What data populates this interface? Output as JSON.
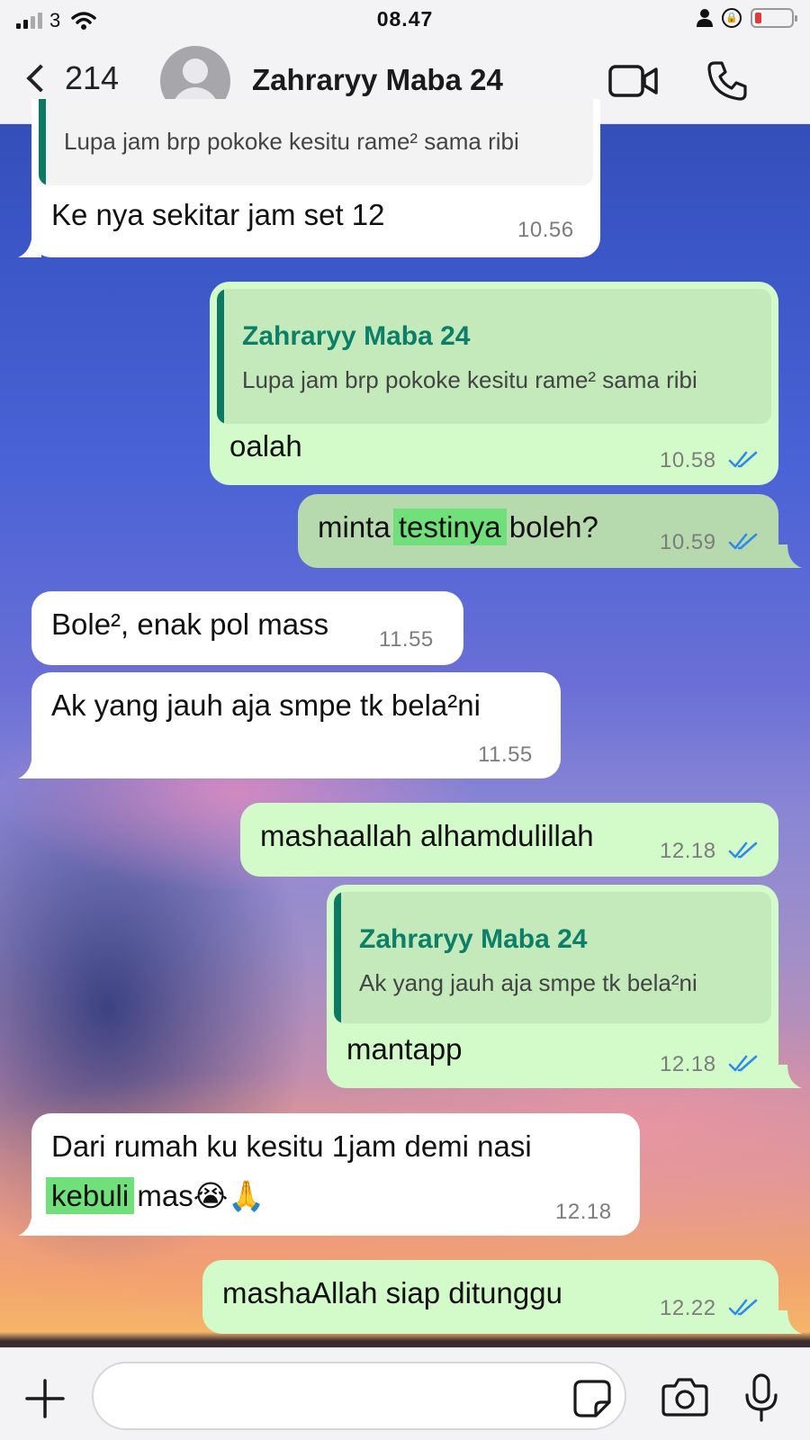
{
  "status_bar": {
    "carrier": "3",
    "time": "08.47"
  },
  "header": {
    "back_count": "214",
    "contact_name": "Zahraryy Maba 24"
  },
  "colors": {
    "incoming_bubble": "#ffffff",
    "outgoing_bubble": "#d3fbc9",
    "selected_bubble": "#b6d9ad",
    "quote_accent": "#0c7a62",
    "read_ticks": "#2e8bea",
    "highlight": "#6fe07a"
  },
  "messages": [
    {
      "direction": "in",
      "quote_text": "Lupa jam brp pokoke kesitu rame² sama ribi",
      "text": "Ke nya sekitar jam set 12",
      "time": "10.56"
    },
    {
      "direction": "out",
      "quote_name": "Zahraryy Maba 24",
      "quote_text": "Lupa jam brp pokoke kesitu rame² sama ribi",
      "text": "oalah",
      "time": "10.58",
      "status": "read"
    },
    {
      "direction": "out",
      "text_before": "minta ",
      "text_highlight": "testinya",
      "text_after": " boleh?",
      "time": "10.59",
      "status": "read"
    },
    {
      "direction": "in",
      "text": "Bole², enak pol mass",
      "time": "11.55"
    },
    {
      "direction": "in",
      "text": "Ak yang jauh aja smpe tk bela²ni",
      "time": "11.55"
    },
    {
      "direction": "out",
      "text": "mashaallah alhamdulillah",
      "time": "12.18",
      "status": "read"
    },
    {
      "direction": "out",
      "quote_name": "Zahraryy Maba 24",
      "quote_text": "Ak yang jauh aja smpe tk bela²ni",
      "text": "mantapp",
      "time": "12.18",
      "status": "read"
    },
    {
      "direction": "in",
      "line1": "Dari rumah ku kesitu 1jam demi nasi",
      "line2_highlight": "kebuli",
      "line2_after": " mas😭🙏",
      "time": "12.18"
    },
    {
      "direction": "out",
      "text": "mashaAllah siap ditunggu",
      "time": "12.22",
      "status": "read"
    }
  ],
  "composer": {
    "icons": [
      "plus-icon",
      "sticker-icon",
      "camera-icon",
      "microphone-icon"
    ]
  }
}
